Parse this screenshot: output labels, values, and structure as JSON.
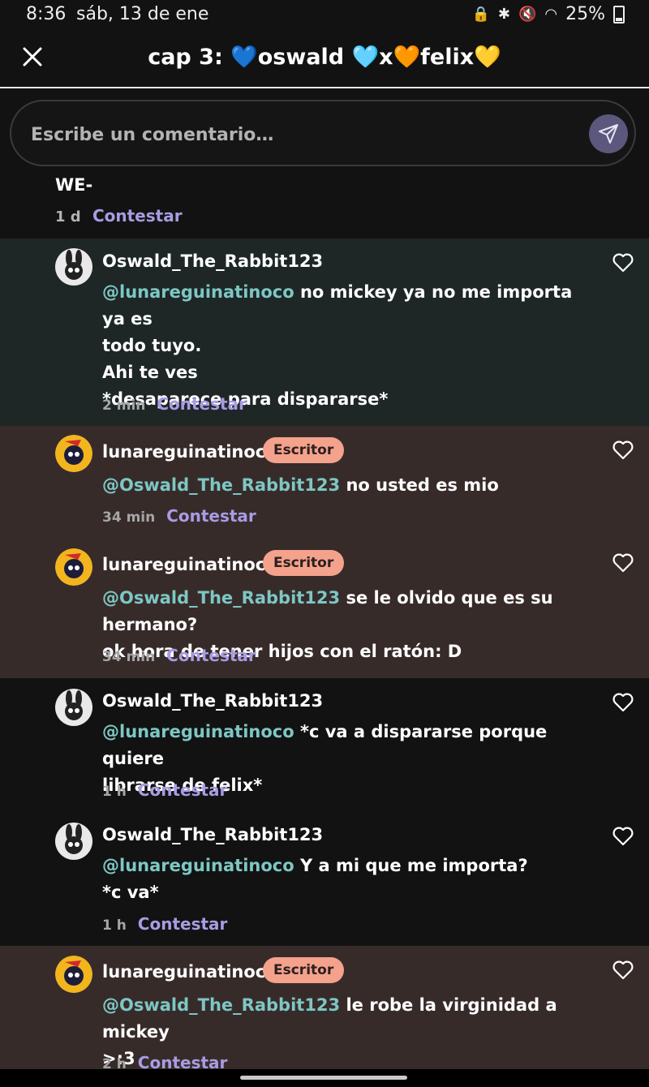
{
  "status": {
    "time": "8:36",
    "date": "sáb, 13 de ene",
    "battery": "25%"
  },
  "header": {
    "title": "cap 3: 💙oswald 🩵x🧡felix💛"
  },
  "composer": {
    "placeholder": "Escribe un comentario…"
  },
  "top_reply": {
    "text": "WE-",
    "time": "1 d",
    "reply_label": "Contestar"
  },
  "comments": [
    {
      "user": "Oswald_The_Rabbit123",
      "badge": "",
      "mention": "@lunareguinatinoco",
      "body_lines": [
        "no mickey ya no me importa ya es",
        "todo tuyo.",
        "Ahi te ves",
        "*desaparece para dispararse*"
      ],
      "time": "2 min",
      "reply_label": "Contestar"
    },
    {
      "user": "lunareguinatinoco",
      "badge": "Escritor",
      "mention": "@Oswald_The_Rabbit123",
      "body_lines": [
        "no usted es mio"
      ],
      "time": "34 min",
      "reply_label": "Contestar"
    },
    {
      "user": "lunareguinatinoco",
      "badge": "Escritor",
      "mention": "@Oswald_The_Rabbit123",
      "body_lines": [
        "se le olvido que es su hermano?",
        "ok hora de tener hijos con el ratón: D"
      ],
      "time": "34 min",
      "reply_label": "Contestar"
    },
    {
      "user": "Oswald_The_Rabbit123",
      "badge": "",
      "mention": "@lunareguinatinoco",
      "body_lines": [
        "*c va a dispararse porque quiere",
        "librarse de felix*"
      ],
      "time": "1 h",
      "reply_label": "Contestar"
    },
    {
      "user": "Oswald_The_Rabbit123",
      "badge": "",
      "mention": "@lunareguinatinoco",
      "body_lines": [
        "Y a mi que me importa?",
        "*c va*"
      ],
      "time": "1 h",
      "reply_label": "Contestar"
    },
    {
      "user": "lunareguinatinoco",
      "badge": "Escritor",
      "mention": "@Oswald_The_Rabbit123",
      "body_lines": [
        "le robe la virginidad a mickey",
        ">:3"
      ],
      "time": "2 h",
      "reply_label": "Contestar"
    }
  ],
  "colors": {
    "mention": "#7dc7c3",
    "link": "#a99be3",
    "badge": "#f4a28c"
  }
}
